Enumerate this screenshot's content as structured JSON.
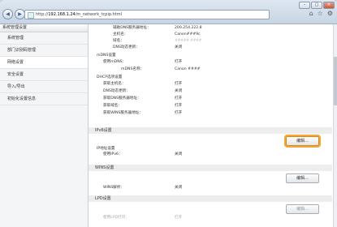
{
  "browser": {
    "url_prefix": "http://",
    "url_host": "192.168.1.24",
    "url_path": "/m_network_tcpip.html",
    "window_controls": [
      "–",
      "▢",
      "✕"
    ],
    "tool_icons": [
      "home-icon",
      "star-icon",
      "gear-icon"
    ]
  },
  "sidebar": {
    "header": "系统管理设置",
    "items": [
      {
        "label": "系统管理"
      },
      {
        "label": "部门识别码管理"
      },
      {
        "label": "网络设置"
      },
      {
        "label": "安全设置"
      },
      {
        "label": "导入/导出"
      },
      {
        "label": "初始化设置信息"
      }
    ]
  },
  "main": {
    "top_rows": [
      {
        "key": "辅助DNS服务器地址：",
        "value": "200.254.222.8"
      },
      {
        "key": "主机名：",
        "value": "Canon###9c"
      },
      {
        "key": "域名：",
        "value": "#####.####"
      },
      {
        "key": "DNS动态更新：",
        "value": "关闭"
      }
    ],
    "mdns_title": "mDNS设置",
    "mdns_rows": [
      {
        "key": "使用mDNS：",
        "value": "打开"
      },
      {
        "key": "mDNS名称：",
        "value": "Canon ####"
      }
    ],
    "dhcp_title": "DHCP选项设置",
    "dhcp_rows": [
      {
        "key": "获取主机名：",
        "value": "打开"
      },
      {
        "key": "DNS动态更新：",
        "value": "关闭"
      },
      {
        "key": "获取DNS服务器地址：",
        "value": "打开"
      },
      {
        "key": "获取域名：",
        "value": "打开"
      },
      {
        "key": "获取WINS服务器地址：",
        "value": "打开"
      }
    ],
    "ipv6_section": "IPv6设置",
    "edit_label": "编辑...",
    "ipaddr_title": "IP地址设置",
    "ipaddr_rows": [
      {
        "key": "使用IPv6：",
        "value": "关闭"
      }
    ],
    "wins_section": "WINS设置",
    "wins_rows": [
      {
        "key": "WINS解析：",
        "value": "关闭"
      }
    ],
    "lpd_section": "LPD设置",
    "lpd_rows": [
      {
        "key": "使用LPD打印：",
        "value": "打开"
      }
    ]
  }
}
